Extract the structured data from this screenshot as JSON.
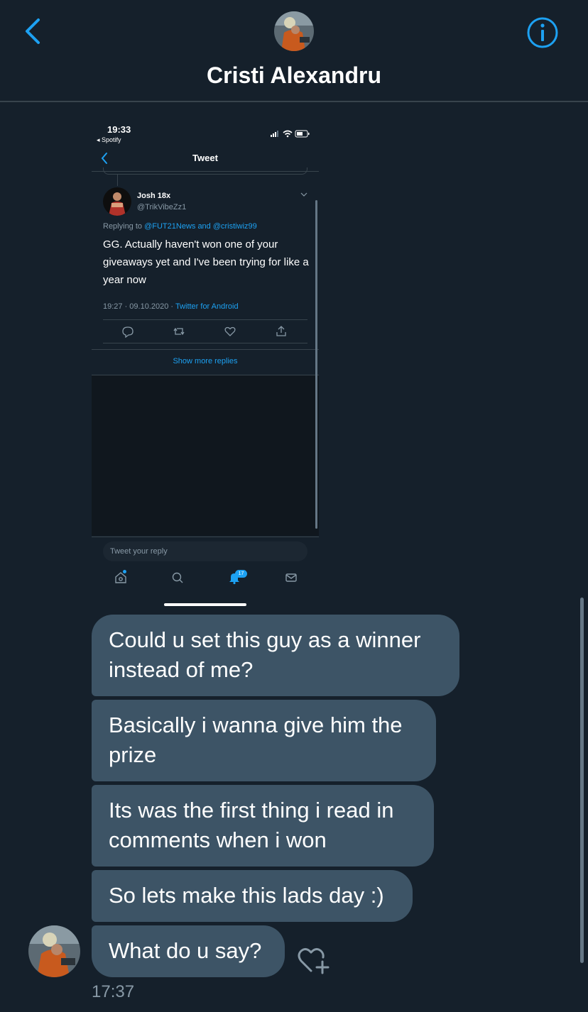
{
  "header": {
    "contact_name": "Cristi Alexandru"
  },
  "screenshot": {
    "status_time": "19:33",
    "back_app": "◂ Spotify",
    "title": "Tweet",
    "tweet": {
      "author_name": "Josh 18x",
      "author_handle": "@TrikVibeZz1",
      "replying_prefix": "Replying to ",
      "replying_mentions": "@FUT21News and @cristiwiz99",
      "body": "GG. Actually haven't won one of your giveaways yet and I've been trying for like a year now",
      "timestamp": "19:27 · 09.10.2020 · ",
      "source": "Twitter for Android"
    },
    "show_more": "Show more replies",
    "reply_placeholder": "Tweet your reply",
    "notifications_count": "17"
  },
  "messages": [
    "Could u set this guy as a winner instead of me?",
    "Basically i wanna give him the prize",
    "Its was the first thing i read in comments when i won",
    "So lets make this lads day :)",
    "What do u say?"
  ],
  "last_timestamp": "17:37",
  "colors": {
    "background": "#15202b",
    "bubble": "#3d5466",
    "accent": "#1da1f2",
    "secondary_text": "#8899a6"
  },
  "icons": [
    "chevron-left-icon",
    "info-icon",
    "heart-plus-icon",
    "reply-icon",
    "retweet-icon",
    "like-icon",
    "share-icon",
    "home-icon",
    "search-icon",
    "bell-icon",
    "mail-icon"
  ]
}
